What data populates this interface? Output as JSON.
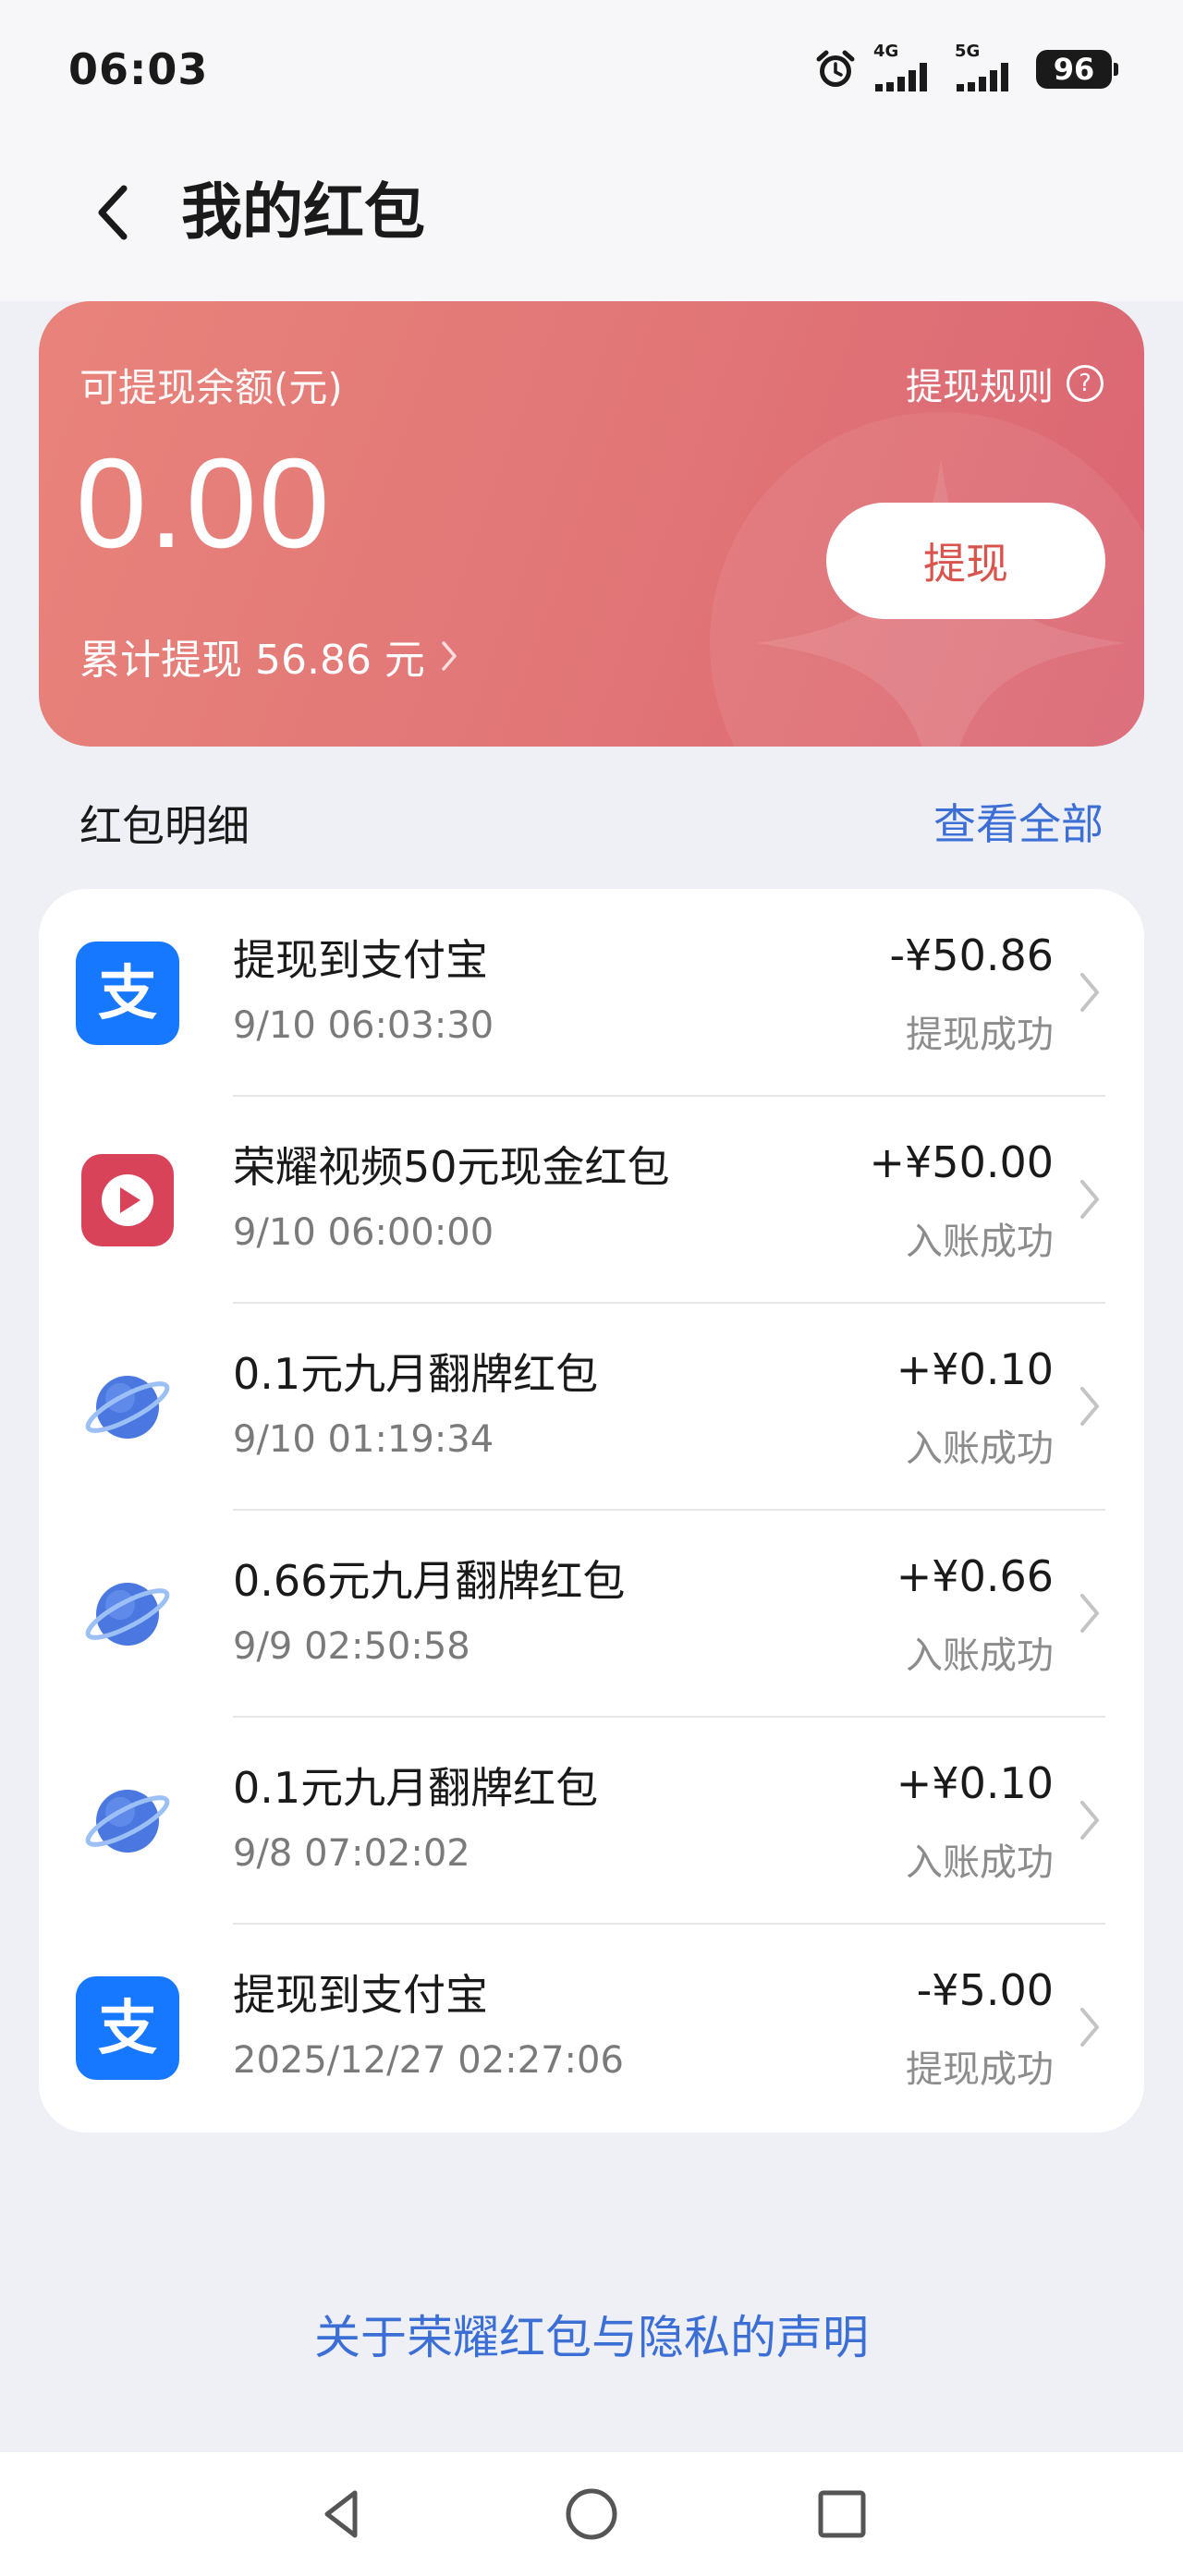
{
  "status_bar": {
    "time": "06:03",
    "network_1": "4G",
    "network_2": "5G",
    "battery": "96",
    "icons": [
      "alarm-icon",
      "signal-4g-icon",
      "signal-5g-icon",
      "battery-icon"
    ]
  },
  "nav": {
    "title": "我的红包",
    "back_icon": "chevron-left-icon"
  },
  "balance": {
    "label": "可提现余额(元)",
    "amount": "0.00",
    "total_withdrawn": "累计提现 56.86 元",
    "rules_label": "提现规则",
    "withdraw_button": "提现"
  },
  "details": {
    "title": "红包明细",
    "view_all": "查看全部",
    "items": [
      {
        "icon": "alipay-icon",
        "title": "提现到支付宝",
        "time": "9/10 06:03:30",
        "amount": "-¥50.86",
        "status": "提现成功"
      },
      {
        "icon": "honor-video-icon",
        "title": "荣耀视频50元现金红包",
        "time": "9/10 06:00:00",
        "amount": "+¥50.00",
        "status": "入账成功"
      },
      {
        "icon": "planet-icon",
        "title": "0.1元九月翻牌红包",
        "time": "9/10 01:19:34",
        "amount": "+¥0.10",
        "status": "入账成功"
      },
      {
        "icon": "planet-icon",
        "title": "0.66元九月翻牌红包",
        "time": "9/9 02:50:58",
        "amount": "+¥0.66",
        "status": "入账成功"
      },
      {
        "icon": "planet-icon",
        "title": "0.1元九月翻牌红包",
        "time": "9/8 07:02:02",
        "amount": "+¥0.10",
        "status": "入账成功"
      },
      {
        "icon": "alipay-icon",
        "title": "提现到支付宝",
        "time": "2025/12/27 02:27:06",
        "amount": "-¥5.00",
        "status": "提现成功"
      }
    ]
  },
  "footer": {
    "privacy_link": "关于荣耀红包与隐私的声明"
  },
  "colors": {
    "accent": "#3c6fd6",
    "card_start": "#e8837a",
    "card_end": "#da6573",
    "withdraw_text": "#d9544d"
  }
}
